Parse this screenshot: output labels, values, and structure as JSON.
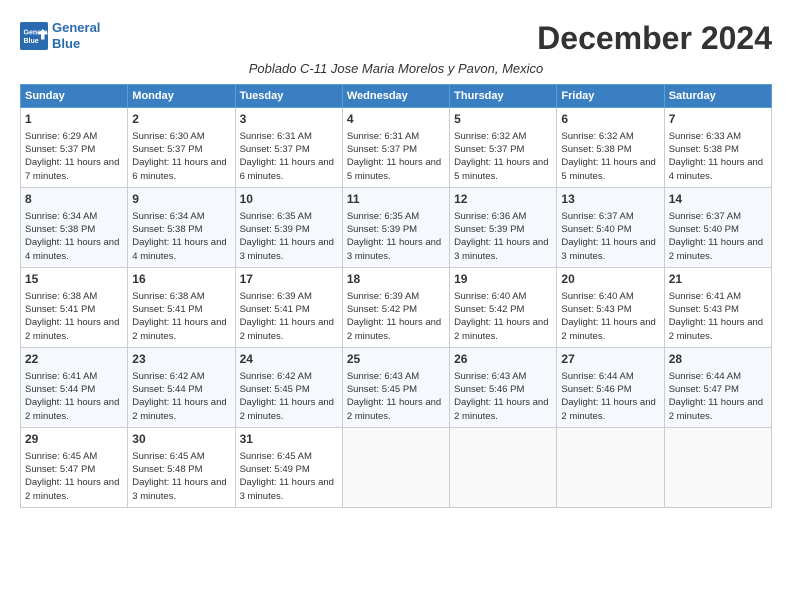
{
  "logo": {
    "line1": "General",
    "line2": "Blue"
  },
  "title": "December 2024",
  "subtitle": "Poblado C-11 Jose Maria Morelos y Pavon, Mexico",
  "days_of_week": [
    "Sunday",
    "Monday",
    "Tuesday",
    "Wednesday",
    "Thursday",
    "Friday",
    "Saturday"
  ],
  "weeks": [
    [
      {
        "day": "1",
        "sunrise": "6:29 AM",
        "sunset": "5:37 PM",
        "daylight": "11 hours and 7 minutes."
      },
      {
        "day": "2",
        "sunrise": "6:30 AM",
        "sunset": "5:37 PM",
        "daylight": "11 hours and 6 minutes."
      },
      {
        "day": "3",
        "sunrise": "6:31 AM",
        "sunset": "5:37 PM",
        "daylight": "11 hours and 6 minutes."
      },
      {
        "day": "4",
        "sunrise": "6:31 AM",
        "sunset": "5:37 PM",
        "daylight": "11 hours and 5 minutes."
      },
      {
        "day": "5",
        "sunrise": "6:32 AM",
        "sunset": "5:37 PM",
        "daylight": "11 hours and 5 minutes."
      },
      {
        "day": "6",
        "sunrise": "6:32 AM",
        "sunset": "5:38 PM",
        "daylight": "11 hours and 5 minutes."
      },
      {
        "day": "7",
        "sunrise": "6:33 AM",
        "sunset": "5:38 PM",
        "daylight": "11 hours and 4 minutes."
      }
    ],
    [
      {
        "day": "8",
        "sunrise": "6:34 AM",
        "sunset": "5:38 PM",
        "daylight": "11 hours and 4 minutes."
      },
      {
        "day": "9",
        "sunrise": "6:34 AM",
        "sunset": "5:38 PM",
        "daylight": "11 hours and 4 minutes."
      },
      {
        "day": "10",
        "sunrise": "6:35 AM",
        "sunset": "5:39 PM",
        "daylight": "11 hours and 3 minutes."
      },
      {
        "day": "11",
        "sunrise": "6:35 AM",
        "sunset": "5:39 PM",
        "daylight": "11 hours and 3 minutes."
      },
      {
        "day": "12",
        "sunrise": "6:36 AM",
        "sunset": "5:39 PM",
        "daylight": "11 hours and 3 minutes."
      },
      {
        "day": "13",
        "sunrise": "6:37 AM",
        "sunset": "5:40 PM",
        "daylight": "11 hours and 3 minutes."
      },
      {
        "day": "14",
        "sunrise": "6:37 AM",
        "sunset": "5:40 PM",
        "daylight": "11 hours and 2 minutes."
      }
    ],
    [
      {
        "day": "15",
        "sunrise": "6:38 AM",
        "sunset": "5:41 PM",
        "daylight": "11 hours and 2 minutes."
      },
      {
        "day": "16",
        "sunrise": "6:38 AM",
        "sunset": "5:41 PM",
        "daylight": "11 hours and 2 minutes."
      },
      {
        "day": "17",
        "sunrise": "6:39 AM",
        "sunset": "5:41 PM",
        "daylight": "11 hours and 2 minutes."
      },
      {
        "day": "18",
        "sunrise": "6:39 AM",
        "sunset": "5:42 PM",
        "daylight": "11 hours and 2 minutes."
      },
      {
        "day": "19",
        "sunrise": "6:40 AM",
        "sunset": "5:42 PM",
        "daylight": "11 hours and 2 minutes."
      },
      {
        "day": "20",
        "sunrise": "6:40 AM",
        "sunset": "5:43 PM",
        "daylight": "11 hours and 2 minutes."
      },
      {
        "day": "21",
        "sunrise": "6:41 AM",
        "sunset": "5:43 PM",
        "daylight": "11 hours and 2 minutes."
      }
    ],
    [
      {
        "day": "22",
        "sunrise": "6:41 AM",
        "sunset": "5:44 PM",
        "daylight": "11 hours and 2 minutes."
      },
      {
        "day": "23",
        "sunrise": "6:42 AM",
        "sunset": "5:44 PM",
        "daylight": "11 hours and 2 minutes."
      },
      {
        "day": "24",
        "sunrise": "6:42 AM",
        "sunset": "5:45 PM",
        "daylight": "11 hours and 2 minutes."
      },
      {
        "day": "25",
        "sunrise": "6:43 AM",
        "sunset": "5:45 PM",
        "daylight": "11 hours and 2 minutes."
      },
      {
        "day": "26",
        "sunrise": "6:43 AM",
        "sunset": "5:46 PM",
        "daylight": "11 hours and 2 minutes."
      },
      {
        "day": "27",
        "sunrise": "6:44 AM",
        "sunset": "5:46 PM",
        "daylight": "11 hours and 2 minutes."
      },
      {
        "day": "28",
        "sunrise": "6:44 AM",
        "sunset": "5:47 PM",
        "daylight": "11 hours and 2 minutes."
      }
    ],
    [
      {
        "day": "29",
        "sunrise": "6:45 AM",
        "sunset": "5:47 PM",
        "daylight": "11 hours and 2 minutes."
      },
      {
        "day": "30",
        "sunrise": "6:45 AM",
        "sunset": "5:48 PM",
        "daylight": "11 hours and 3 minutes."
      },
      {
        "day": "31",
        "sunrise": "6:45 AM",
        "sunset": "5:49 PM",
        "daylight": "11 hours and 3 minutes."
      },
      null,
      null,
      null,
      null
    ]
  ]
}
